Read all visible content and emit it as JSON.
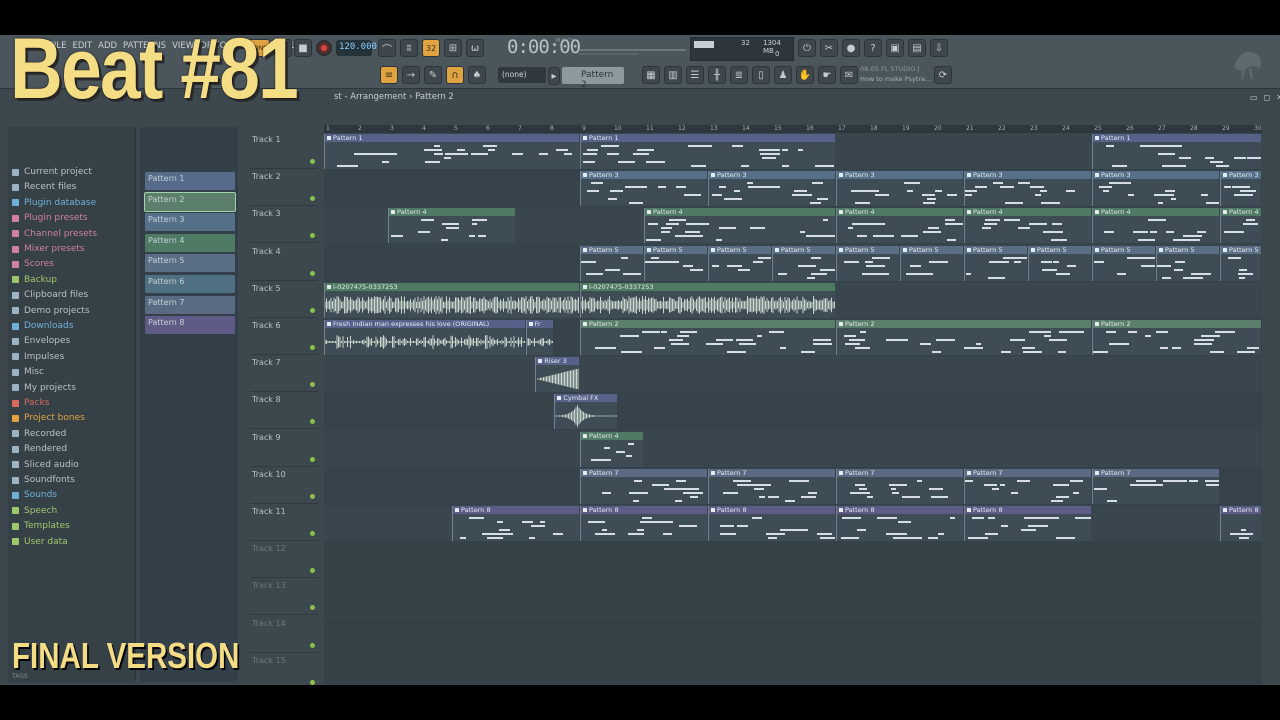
{
  "overlay": {
    "title": "Beat #81",
    "subtitle": "FINAL VERSION"
  },
  "menu": [
    "FILE",
    "EDIT",
    "ADD",
    "PATTERNS",
    "VIEW",
    "OPTIONS",
    "TOOLS",
    "HELP"
  ],
  "transport": {
    "tempo": "120.000",
    "time": "0:00:00",
    "time_label": "M:S:CS"
  },
  "monitor": {
    "cpu": "32",
    "memory": "1304 MB",
    "polyphony": "0"
  },
  "toolbar": {
    "snap": "(none)",
    "pattern": "Pattern 2"
  },
  "hint": {
    "line1": "08-05 FL STUDIO |",
    "line2": "How to make Psytra..."
  },
  "playlist": {
    "title": "st - Arrangement › Pattern 2"
  },
  "browser": {
    "items": [
      {
        "label": "Current project",
        "color": "#9fb3c0"
      },
      {
        "label": "Recent files",
        "color": "#9fb3c0"
      },
      {
        "label": "Plugin database",
        "color": "#6fb1d6"
      },
      {
        "label": "Plugin presets",
        "color": "#d07fa7"
      },
      {
        "label": "Channel presets",
        "color": "#d07fa7"
      },
      {
        "label": "Mixer presets",
        "color": "#d07fa7"
      },
      {
        "label": "Scores",
        "color": "#d07fa7"
      },
      {
        "label": "Backup",
        "color": "#9fc76b"
      },
      {
        "label": "Clipboard files",
        "color": "#9fb3c0"
      },
      {
        "label": "Demo projects",
        "color": "#9fb3c0"
      },
      {
        "label": "Downloads",
        "color": "#6fb1d6"
      },
      {
        "label": "Envelopes",
        "color": "#9fb3c0"
      },
      {
        "label": "Impulses",
        "color": "#9fb3c0"
      },
      {
        "label": "Misc",
        "color": "#9fb3c0"
      },
      {
        "label": "My projects",
        "color": "#9fb3c0"
      },
      {
        "label": "Packs",
        "color": "#d86a5f"
      },
      {
        "label": "Project bones",
        "color": "#e0a341"
      },
      {
        "label": "Recorded",
        "color": "#9fb3c0"
      },
      {
        "label": "Rendered",
        "color": "#9fb3c0"
      },
      {
        "label": "Sliced audio",
        "color": "#9fb3c0"
      },
      {
        "label": "Soundfonts",
        "color": "#9fb3c0"
      },
      {
        "label": "Sounds",
        "color": "#6fb1d6"
      },
      {
        "label": "Speech",
        "color": "#9fc76b"
      },
      {
        "label": "Templates",
        "color": "#9fc76b"
      },
      {
        "label": "User data",
        "color": "#9fc76b"
      }
    ],
    "tags_label": "TAGS"
  },
  "patterns": [
    {
      "label": "Pattern 1",
      "color": "#566a8a"
    },
    {
      "label": "Pattern 2",
      "color": "#5b7f6a"
    },
    {
      "label": "Pattern 3",
      "color": "#56708a"
    },
    {
      "label": "Pattern 4",
      "color": "#4f7a64"
    },
    {
      "label": "Pattern 5",
      "color": "#5a6e86"
    },
    {
      "label": "Pattern 6",
      "color": "#4f6f82"
    },
    {
      "label": "Pattern 7",
      "color": "#5a6a82"
    },
    {
      "label": "Pattern 8",
      "color": "#5e5c86"
    }
  ],
  "bars": [
    1,
    2,
    3,
    4,
    5,
    6,
    7,
    8,
    9,
    10,
    11,
    12,
    13,
    14,
    15,
    16,
    17,
    18,
    19,
    20,
    21,
    22,
    23,
    24,
    25,
    26,
    27,
    28,
    29,
    30
  ],
  "tracks": [
    "Track 1",
    "Track 2",
    "Track 3",
    "Track 4",
    "Track 5",
    "Track 6",
    "Track 7",
    "Track 8",
    "Track 9",
    "Track 10",
    "Track 11",
    "Track 12",
    "Track 13",
    "Track 14",
    "Track 15"
  ],
  "clips": [
    {
      "track": 0,
      "start": 1,
      "len": 8,
      "label": "Pattern 1",
      "color": "#56628a"
    },
    {
      "track": 0,
      "start": 9,
      "len": 8,
      "label": "Pattern 1",
      "color": "#56628a"
    },
    {
      "track": 0,
      "start": 25,
      "len": 5.3,
      "label": "Pattern 1",
      "color": "#56628a"
    },
    {
      "track": 1,
      "start": 9,
      "len": 4,
      "label": "Pattern 3",
      "color": "#56708a"
    },
    {
      "track": 1,
      "start": 13,
      "len": 4,
      "label": "Pattern 3",
      "color": "#56708a"
    },
    {
      "track": 1,
      "start": 17,
      "len": 4,
      "label": "Pattern 3",
      "color": "#56708a"
    },
    {
      "track": 1,
      "start": 21,
      "len": 4,
      "label": "Pattern 3",
      "color": "#56708a"
    },
    {
      "track": 1,
      "start": 25,
      "len": 4,
      "label": "Pattern 3",
      "color": "#56708a"
    },
    {
      "track": 1,
      "start": 29,
      "len": 1.3,
      "label": "Pattern 3",
      "color": "#56708a"
    },
    {
      "track": 2,
      "start": 3,
      "len": 4,
      "label": "Pattern 4",
      "color": "#4f7a64"
    },
    {
      "track": 2,
      "start": 11,
      "len": 6,
      "label": "Pattern 4",
      "color": "#4f7a64"
    },
    {
      "track": 2,
      "start": 17,
      "len": 4,
      "label": "Pattern 4",
      "color": "#4f7a64"
    },
    {
      "track": 2,
      "start": 21,
      "len": 4,
      "label": "Pattern 4",
      "color": "#4f7a64"
    },
    {
      "track": 2,
      "start": 25,
      "len": 4,
      "label": "Pattern 4",
      "color": "#4f7a64"
    },
    {
      "track": 2,
      "start": 29,
      "len": 1.3,
      "label": "Pattern 4",
      "color": "#4f7a64"
    },
    {
      "track": 3,
      "start": 9,
      "len": 2,
      "label": "Pattern 5",
      "color": "#5a6e86"
    },
    {
      "track": 3,
      "start": 11,
      "len": 2,
      "label": "Pattern 5",
      "color": "#5a6e86"
    },
    {
      "track": 3,
      "start": 13,
      "len": 2,
      "label": "Pattern 5",
      "color": "#5a6e86"
    },
    {
      "track": 3,
      "start": 15,
      "len": 2,
      "label": "Pattern 5",
      "color": "#5a6e86"
    },
    {
      "track": 3,
      "start": 17,
      "len": 2,
      "label": "Pattern 5",
      "color": "#5a6e86"
    },
    {
      "track": 3,
      "start": 19,
      "len": 2,
      "label": "Pattern 5",
      "color": "#5a6e86"
    },
    {
      "track": 3,
      "start": 21,
      "len": 2,
      "label": "Pattern 5",
      "color": "#5a6e86"
    },
    {
      "track": 3,
      "start": 23,
      "len": 2,
      "label": "Pattern 5",
      "color": "#5a6e86"
    },
    {
      "track": 3,
      "start": 25,
      "len": 2,
      "label": "Pattern 5",
      "color": "#5a6e86"
    },
    {
      "track": 3,
      "start": 27,
      "len": 2,
      "label": "Pattern 5",
      "color": "#5a6e86"
    },
    {
      "track": 3,
      "start": 29,
      "len": 1.3,
      "label": "Pattern 5",
      "color": "#5a6e86"
    },
    {
      "track": 4,
      "start": 1,
      "len": 8,
      "label": "I-0207475-0337253",
      "color": "#4f7a64",
      "audio": true
    },
    {
      "track": 4,
      "start": 9,
      "len": 8,
      "label": "I-0207475-0337253",
      "color": "#4f7a64",
      "audio": true
    },
    {
      "track": 5,
      "start": 1,
      "len": 6.3,
      "label": "Fresh Indian man expresses his love (ORIGINAL)",
      "color": "#56628a",
      "audio": true
    },
    {
      "track": 5,
      "start": 7.3,
      "len": 0.9,
      "label": "Fr",
      "color": "#56628a",
      "audio": true
    },
    {
      "track": 5,
      "start": 9,
      "len": 8,
      "label": "Pattern 2",
      "color": "#5b7f6a"
    },
    {
      "track": 5,
      "start": 17,
      "len": 8,
      "label": "Pattern 2",
      "color": "#5b7f6a"
    },
    {
      "track": 5,
      "start": 25,
      "len": 5.3,
      "label": "Pattern 2",
      "color": "#5b7f6a"
    },
    {
      "track": 6,
      "start": 7.6,
      "len": 1.4,
      "label": "Riser 3",
      "color": "#56628a",
      "audio": true,
      "riser": true
    },
    {
      "track": 7,
      "start": 8.2,
      "len": 2,
      "label": "Cymbal FX",
      "color": "#56628a",
      "audio": true,
      "cymbal": true
    },
    {
      "track": 8,
      "start": 9,
      "len": 2,
      "label": "Pattern 4",
      "color": "#4f7a64"
    },
    {
      "track": 9,
      "start": 9,
      "len": 4,
      "label": "Pattern 7",
      "color": "#5a6a82"
    },
    {
      "track": 9,
      "start": 13,
      "len": 4,
      "label": "Pattern 7",
      "color": "#5a6a82"
    },
    {
      "track": 9,
      "start": 17,
      "len": 4,
      "label": "Pattern 7",
      "color": "#5a6a82"
    },
    {
      "track": 9,
      "start": 21,
      "len": 4,
      "label": "Pattern 7",
      "color": "#5a6a82"
    },
    {
      "track": 9,
      "start": 25,
      "len": 4,
      "label": "Pattern 7",
      "color": "#5a6a82"
    },
    {
      "track": 10,
      "start": 5,
      "len": 4,
      "label": "Pattern 8",
      "color": "#5e5c86"
    },
    {
      "track": 10,
      "start": 9,
      "len": 4,
      "label": "Pattern 8",
      "color": "#5e5c86"
    },
    {
      "track": 10,
      "start": 13,
      "len": 4,
      "label": "Pattern 8",
      "color": "#5e5c86"
    },
    {
      "track": 10,
      "start": 17,
      "len": 4,
      "label": "Pattern 8",
      "color": "#5e5c86"
    },
    {
      "track": 10,
      "start": 21,
      "len": 4,
      "label": "Pattern 8",
      "color": "#5e5c86"
    },
    {
      "track": 10,
      "start": 29,
      "len": 1.3,
      "label": "Pattern 8",
      "color": "#5e5c86"
    }
  ]
}
